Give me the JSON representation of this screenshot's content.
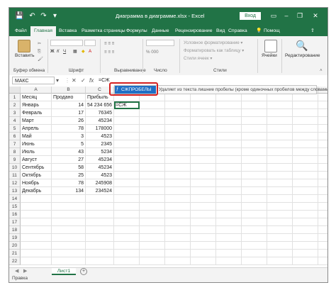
{
  "window": {
    "title": "Диаграмма в диаграмме.xlsx - Excel",
    "login": "Вход",
    "minimize": "–",
    "restore": "❐",
    "close": "✕",
    "qat_save": "💾",
    "qat_undo": "↶",
    "qat_redo": "↷",
    "qat_more": "▾"
  },
  "ribbon_tabs": [
    "Файл",
    "Главная",
    "Вставка",
    "Разметка страницы",
    "Формулы",
    "Данные",
    "Рецензирование",
    "Вид",
    "Справка"
  ],
  "ribbon_right": {
    "help_search": "Помощ",
    "share": ""
  },
  "ribbon": {
    "paste": "Вставить",
    "clipboard": "Буфер обмена",
    "font": "Шрифт",
    "alignment": "Выравнивание",
    "number": "Число",
    "styles": "Стили",
    "cells": "Ячейки",
    "editing": "Редактирование",
    "styles_items": [
      "Условное форматирование ▾",
      "Форматировать как таблицу ▾",
      "Стили ячеек ▾"
    ]
  },
  "formula_bar": {
    "name_box": "МАКС",
    "cancel": "✕",
    "enter": "✓",
    "fx": "fx",
    "content": "=СЖ"
  },
  "autocomplete": {
    "function": "СЖПРОБЕЛЫ",
    "description": "Удаляет из текста лишние пробелы (кроме одиночных пробелов между словами)"
  },
  "columns": [
    "A",
    "B",
    "C",
    "D",
    "E",
    "F",
    "G",
    "H",
    "I",
    "J",
    "K",
    "L"
  ],
  "rows": [
    "1",
    "2",
    "3",
    "4",
    "5",
    "6",
    "7",
    "8",
    "9",
    "10",
    "11",
    "12",
    "13",
    "14",
    "15",
    "16",
    "17",
    "18",
    "19",
    "20",
    "21",
    "22"
  ],
  "table": {
    "headers": [
      "Месяц",
      "Продано",
      "Прибыль"
    ],
    "data": [
      [
        "Январь",
        "14",
        "54 234 656"
      ],
      [
        "Февраль",
        "17",
        "76345"
      ],
      [
        "Март",
        "26",
        "45234"
      ],
      [
        "Апрель",
        "78",
        "178000"
      ],
      [
        "Май",
        "3",
        "4523"
      ],
      [
        "Июнь",
        "5",
        "2345"
      ],
      [
        "Июль",
        "43",
        "5234"
      ],
      [
        "Август",
        "27",
        "45234"
      ],
      [
        "Сентябрь",
        "58",
        "45234"
      ],
      [
        "Октябрь",
        "25",
        "4523"
      ],
      [
        "Ноябрь",
        "78",
        "245908"
      ],
      [
        "Декабрь",
        "134",
        "234524"
      ]
    ],
    "editing_cell_value": "=СЖ"
  },
  "sheets": [
    "Лист1"
  ],
  "add_sheet": "+",
  "status": "Правка",
  "colors": {
    "accent": "#217346",
    "tooltip_blue": "#1f6fc5",
    "callout_red": "#d42020"
  }
}
